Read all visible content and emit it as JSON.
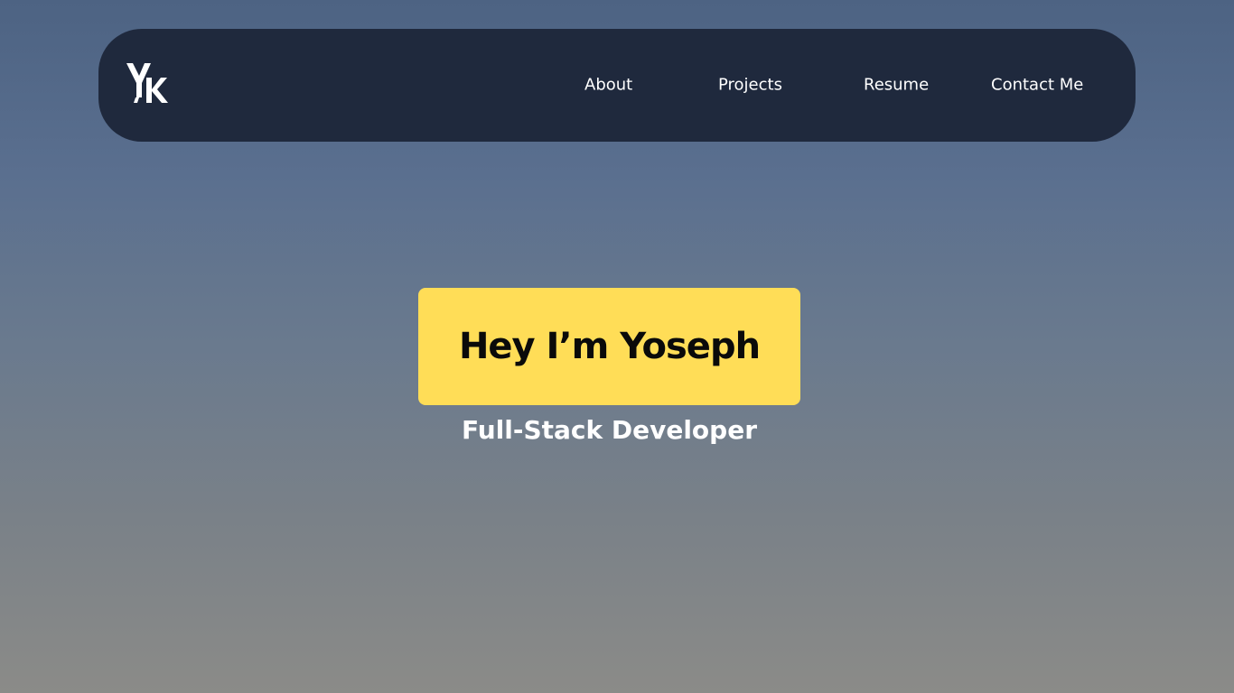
{
  "header": {
    "logo_icon": "yk-monogram-logo",
    "nav": [
      {
        "label": "About"
      },
      {
        "label": "Projects"
      },
      {
        "label": "Resume"
      },
      {
        "label": "Contact Me"
      }
    ]
  },
  "hero": {
    "title": "Hey I’m Yoseph",
    "subtitle": "Full-Stack Developer"
  },
  "colors": {
    "navbar_bg": "#1f293d",
    "hero_accent": "#ffdd57",
    "nav_text": "#ffffff"
  }
}
